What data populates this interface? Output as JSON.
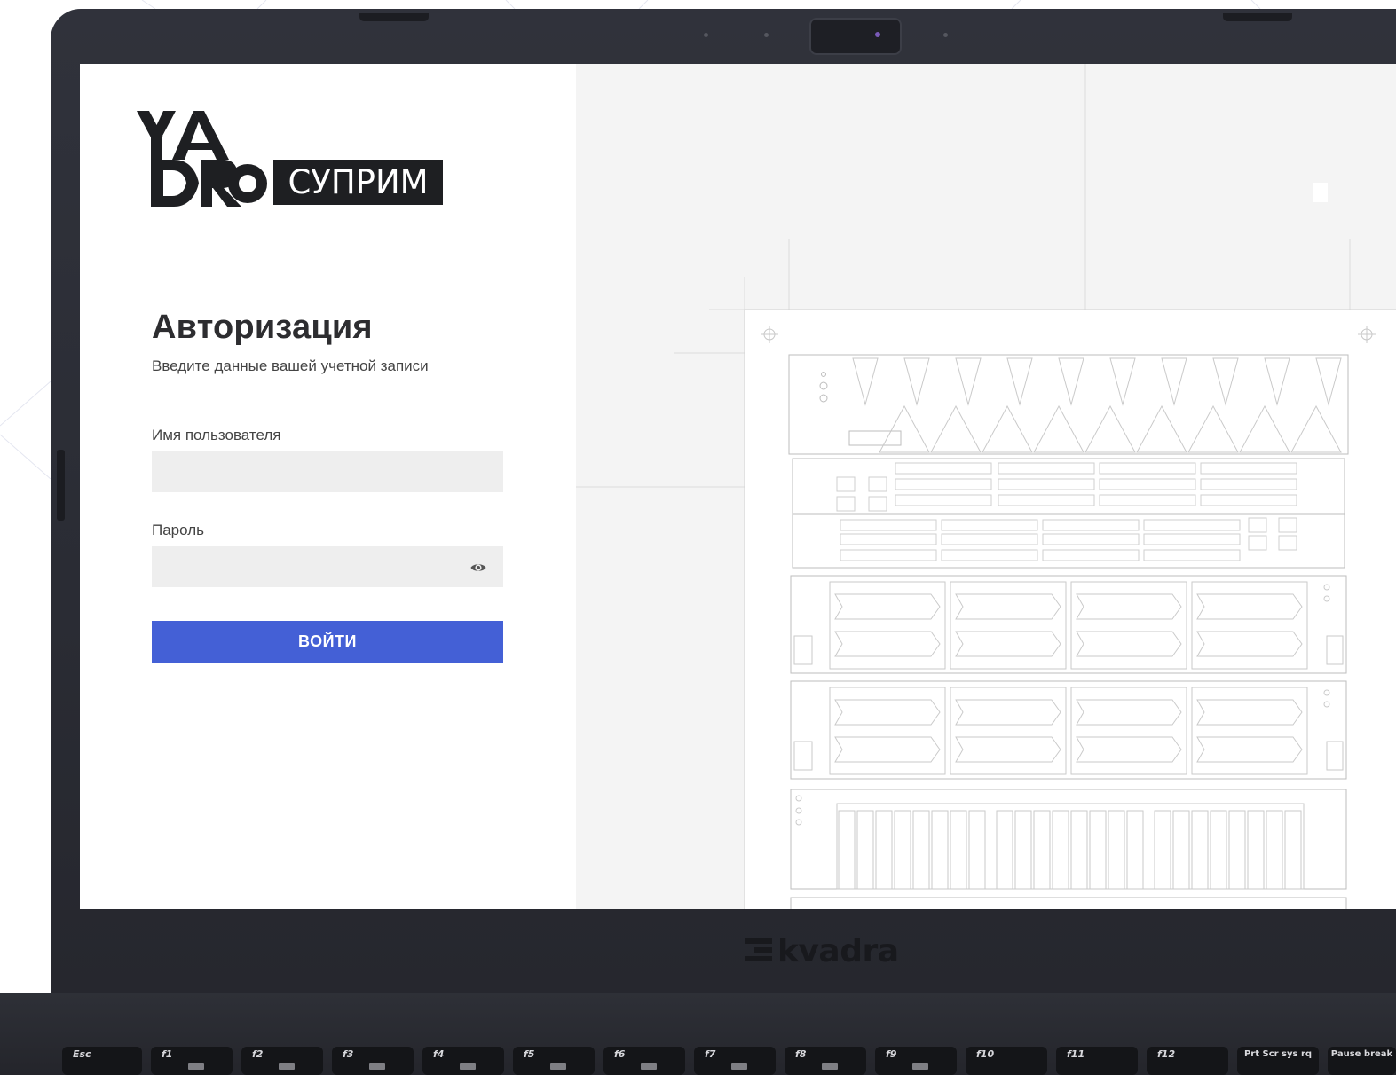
{
  "brand": {
    "logo_word": "СУПРИМ",
    "laptop_brand": "kvadra"
  },
  "login": {
    "title": "Авторизация",
    "subtitle": "Введите данные вашей учетной записи",
    "username_label": "Имя пользователя",
    "username_value": "",
    "password_label": "Пароль",
    "password_value": "",
    "submit_label": "ВОЙТИ"
  },
  "icons": {
    "show_password": "eye-icon",
    "logo": "yadro-logo"
  },
  "colors": {
    "accent": "#4460d6",
    "input_bg": "#eeeeee",
    "right_panel_bg": "#f4f4f4",
    "laptop_body": "#2b2d35"
  },
  "keyboard": {
    "keys": [
      "Esc",
      "f1",
      "f2",
      "f3",
      "f4",
      "f5",
      "f6",
      "f7",
      "f8",
      "f9",
      "f10",
      "f11",
      "f12",
      "Prt Scr sys rq",
      "Pause break"
    ]
  }
}
